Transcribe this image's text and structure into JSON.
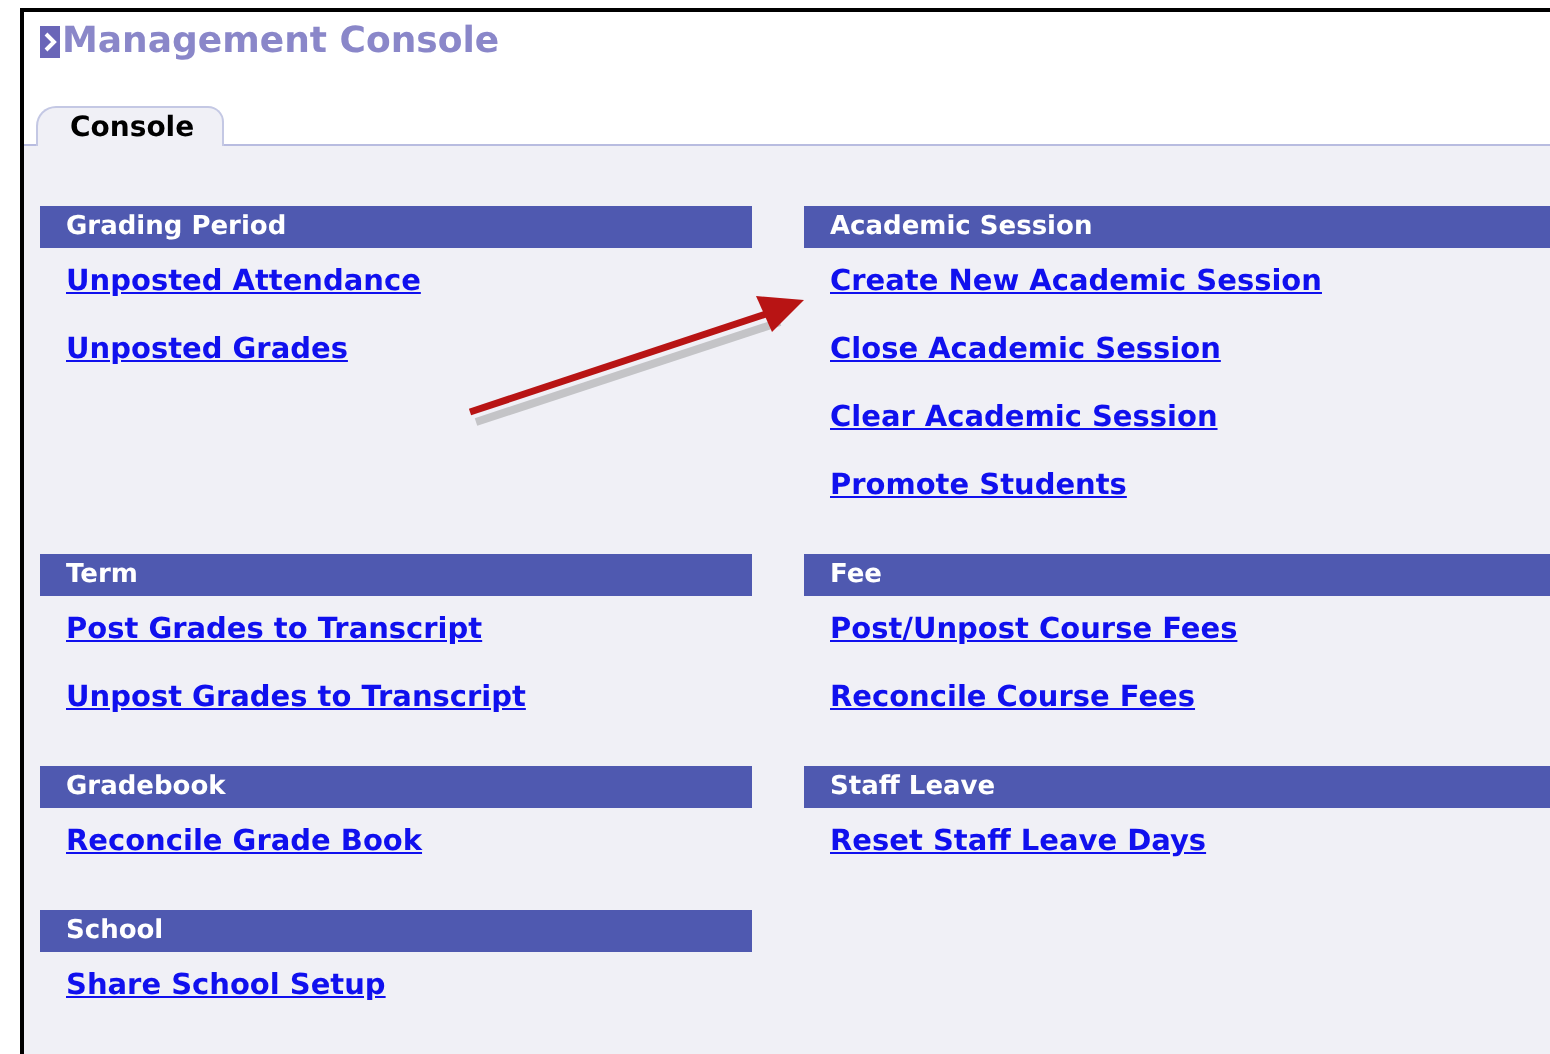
{
  "window": {
    "title": "Management Console"
  },
  "tabs": [
    {
      "label": "Console",
      "selected": true
    }
  ],
  "rows": [
    {
      "sections": [
        {
          "title": "Grading Period",
          "links": [
            "Unposted Attendance",
            "Unposted Grades"
          ]
        },
        {
          "title": "Academic Session",
          "links": [
            "Create New Academic Session",
            "Close Academic Session",
            "Clear Academic Session",
            "Promote Students"
          ]
        }
      ]
    },
    {
      "sections": [
        {
          "title": "Term",
          "links": [
            "Post Grades to Transcript",
            "Unpost Grades to Transcript"
          ]
        },
        {
          "title": "Fee",
          "links": [
            "Post/Unpost Course Fees",
            "Reconcile Course Fees"
          ]
        }
      ]
    },
    {
      "sections": [
        {
          "title": "Gradebook",
          "links": [
            "Reconcile Grade Book"
          ]
        },
        {
          "title": "Staff Leave",
          "links": [
            "Reset Staff Leave Days"
          ]
        }
      ]
    },
    {
      "sections": [
        {
          "title": "School",
          "links": [
            "Share School Setup"
          ]
        }
      ]
    }
  ]
}
